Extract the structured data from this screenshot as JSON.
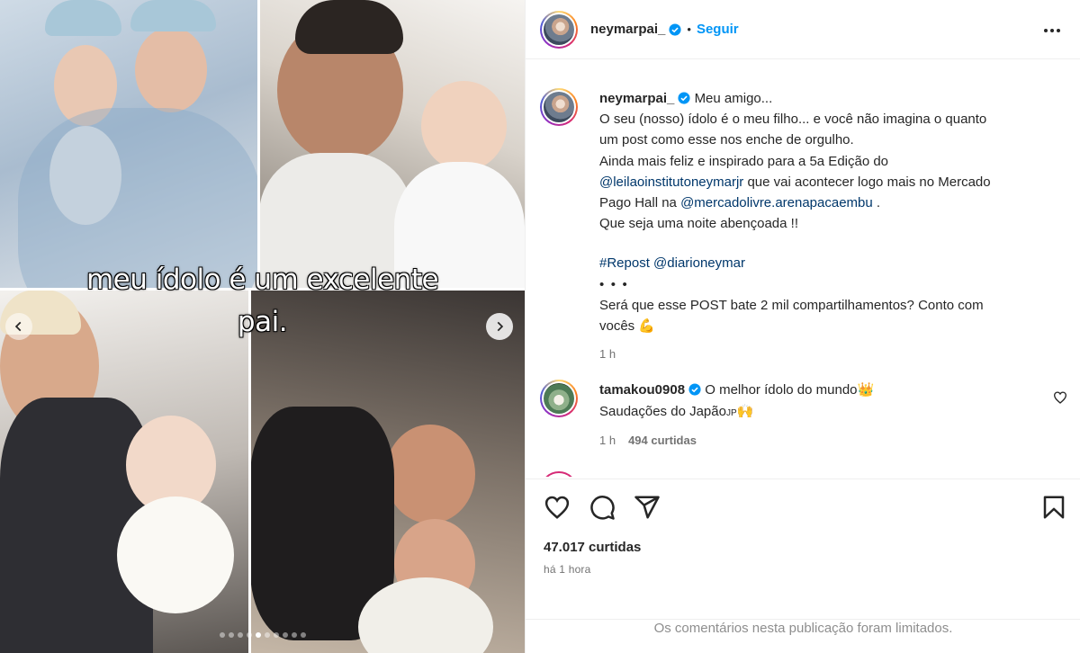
{
  "post": {
    "author": "neymarpai_",
    "follow_label": "Seguir",
    "caption_lines": [
      "O seu (nosso) ídolo é o meu filho... e você não imagina o quanto",
      "um post como esse nos enche de orgulho."
    ],
    "caption_intro": "Meu amigo...",
    "line3": "Ainda mais feliz e inspirado para a 5a Edição do",
    "mention1": "@leilaoinstitutoneymarjr",
    "line4_rest": " que vai acontecer logo mais no Mercado",
    "line5_start": "Pago Hall na ",
    "mention2": "@mercadolivre.arenapacaembu",
    "line5_end": " .",
    "line6": "Que seja uma noite abençoada !!",
    "hashtag": "#Repost",
    "mention3": "@diarioneymar",
    "dots_line": "• • •",
    "question_line1": "Será que esse POST bate 2 mil compartilhamentos? Conto com",
    "question_line2": "vocês ",
    "question_emoji": "💪",
    "time": "1 h"
  },
  "media": {
    "overlay_line1": "meu ídolo é um excelente",
    "overlay_line2": "pai.",
    "slide_count": 10,
    "active_slide": 4
  },
  "comment": {
    "author": "tamakou0908",
    "text": "O melhor ídolo do mundo",
    "emoji1": "👑",
    "line2": "Saudações do Japão",
    "line2_suffix": "JP",
    "emoji2": "🙌",
    "time": "1 h",
    "likes": "494 curtidas"
  },
  "footer": {
    "likes": "47.017 curtidas",
    "posted": "há 1 hora",
    "comments_limited": "Os comentários nesta publicação foram limitados."
  },
  "colors": {
    "follow_blue": "#0095f6",
    "link": "#00376b",
    "muted": "#737373",
    "verified": "#0095f6"
  },
  "icons": [
    "chevron-left-icon",
    "chevron-right-icon",
    "verified-icon",
    "more-icon",
    "heart-icon",
    "comment-icon",
    "share-icon",
    "bookmark-icon"
  ]
}
